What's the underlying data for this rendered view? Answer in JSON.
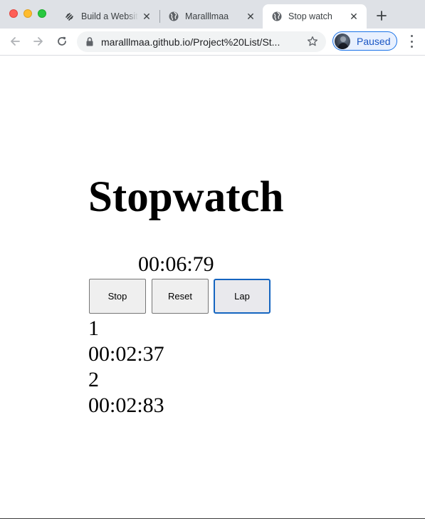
{
  "browser": {
    "tabs": [
      {
        "title": "Build a Website",
        "icon": "squarespace-icon",
        "active": false
      },
      {
        "title": "Maralllmaa",
        "icon": "globe-icon",
        "active": false
      },
      {
        "title": "Stop watch",
        "icon": "globe-icon",
        "active": true
      }
    ],
    "url": "maralllmaa.github.io/Project%20List/St...",
    "profile_label": "Paused",
    "accent_color": "#1a73e8"
  },
  "app": {
    "heading": "Stopwatch",
    "timer": "00:06:79",
    "buttons": {
      "stop": "Stop",
      "reset": "Reset",
      "lap": "Lap"
    },
    "laps": [
      {
        "number": "1",
        "time": "00:02:37"
      },
      {
        "number": "2",
        "time": "00:02:83"
      }
    ]
  }
}
